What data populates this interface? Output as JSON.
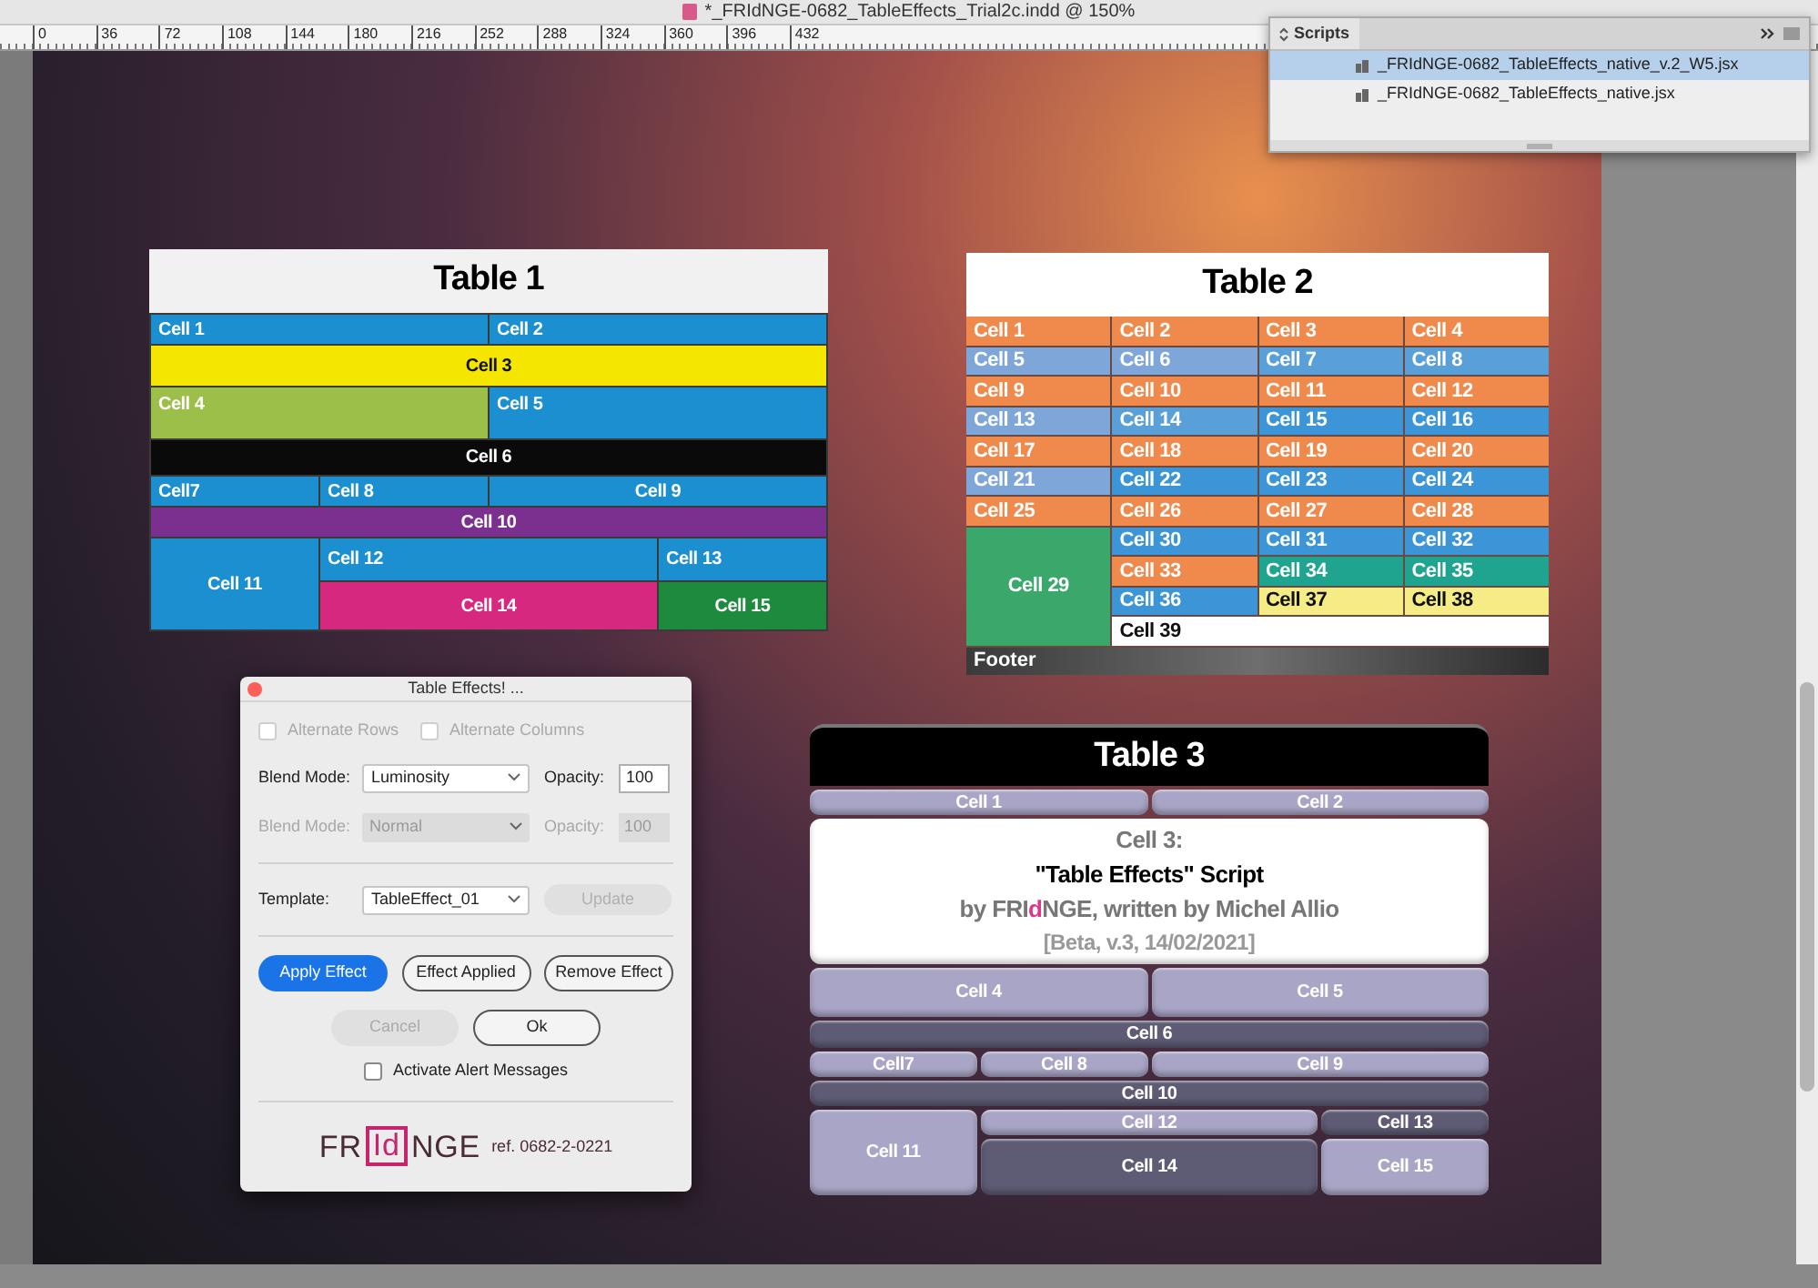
{
  "window": {
    "title": "*_FRIdNGE-0682_TableEffects_Trial2c.indd @ 150%"
  },
  "ruler": {
    "ticks": [
      "0",
      "36",
      "72",
      "108",
      "144",
      "180",
      "216",
      "252",
      "288",
      "324",
      "360",
      "396",
      "432"
    ]
  },
  "scripts_panel": {
    "tab": "Scripts",
    "items": [
      {
        "label": "_FRIdNGE-0682_TableEffects_native_v.2_W5.jsx",
        "selected": true
      },
      {
        "label": "_FRIdNGE-0682_TableEffects_native.jsx",
        "selected": false
      }
    ]
  },
  "table_1": {
    "title": "Table 1",
    "cells": [
      {
        "text": "Cell 1",
        "color": "#1b8fd0"
      },
      {
        "text": "Cell 2",
        "color": "#1b8fd0"
      },
      {
        "text": "Cell 3",
        "color": "#f5e600"
      },
      {
        "text": "Cell 4",
        "color": "#9cbf4a"
      },
      {
        "text": "Cell 5",
        "color": "#1b8fd0"
      },
      {
        "text": "Cell 6",
        "color": "#0a0a0a"
      },
      {
        "text": "Cell7",
        "color": "#1b8fd0"
      },
      {
        "text": "Cell 8",
        "color": "#1b8fd0"
      },
      {
        "text": "Cell 9",
        "color": "#1b8fd0"
      },
      {
        "text": "Cell 10",
        "color": "#7b2f8f"
      },
      {
        "text": "Cell 11",
        "color": "#1b8fd0"
      },
      {
        "text": "Cell 12",
        "color": "#1b8fd0"
      },
      {
        "text": "Cell 13",
        "color": "#1b8fd0"
      },
      {
        "text": "Cell 14",
        "color": "#d6287e"
      },
      {
        "text": "Cell 15",
        "color": "#1e8a3e"
      }
    ]
  },
  "table_2": {
    "title": "Table 2",
    "cells": [
      {
        "text": "Cell 1",
        "color": "#ef8a4c"
      },
      {
        "text": "Cell 2",
        "color": "#ef8a4c"
      },
      {
        "text": "Cell 3",
        "color": "#ef8a4c"
      },
      {
        "text": "Cell 4",
        "color": "#ef8a4c"
      },
      {
        "text": "Cell 5",
        "color": "#7fa6d8"
      },
      {
        "text": "Cell 6",
        "color": "#7fa6d8"
      },
      {
        "text": "Cell 7",
        "color": "#5aa0d8"
      },
      {
        "text": "Cell 8",
        "color": "#5aa0d8"
      },
      {
        "text": "Cell 9",
        "color": "#ef8a4c"
      },
      {
        "text": "Cell 10",
        "color": "#ef8a4c"
      },
      {
        "text": "Cell 11",
        "color": "#ef8a4c"
      },
      {
        "text": "Cell 12",
        "color": "#ef8a4c"
      },
      {
        "text": "Cell 13",
        "color": "#7fa6d8"
      },
      {
        "text": "Cell 14",
        "color": "#5aa0d8"
      },
      {
        "text": "Cell 15",
        "color": "#3c95d6"
      },
      {
        "text": "Cell 16",
        "color": "#3c95d6"
      },
      {
        "text": "Cell 17",
        "color": "#ef8a4c"
      },
      {
        "text": "Cell 18",
        "color": "#ef8a4c"
      },
      {
        "text": "Cell 19",
        "color": "#ef8a4c"
      },
      {
        "text": "Cell 20",
        "color": "#ef8a4c"
      },
      {
        "text": "Cell 21",
        "color": "#7fa6d8"
      },
      {
        "text": "Cell 22",
        "color": "#3c95d6"
      },
      {
        "text": "Cell 23",
        "color": "#3c95d6"
      },
      {
        "text": "Cell 24",
        "color": "#3c95d6"
      },
      {
        "text": "Cell 25",
        "color": "#ef8a4c"
      },
      {
        "text": "Cell 26",
        "color": "#ef8a4c"
      },
      {
        "text": "Cell 27",
        "color": "#ef8a4c"
      },
      {
        "text": "Cell 28",
        "color": "#ef8a4c"
      },
      {
        "text": "Cell 29",
        "color": "#3aa86a"
      },
      {
        "text": "Cell 30",
        "color": "#3c95d6"
      },
      {
        "text": "Cell 31",
        "color": "#3c95d6"
      },
      {
        "text": "Cell 32",
        "color": "#3c95d6"
      },
      {
        "text": "Cell 33",
        "color": "#ef8a4c"
      },
      {
        "text": "Cell 34",
        "color": "#1fa58f"
      },
      {
        "text": "Cell 35",
        "color": "#1fa58f"
      },
      {
        "text": "Cell 36",
        "color": "#3c95d6"
      },
      {
        "text": "Cell 37",
        "color": "#f6ec86"
      },
      {
        "text": "Cell 38",
        "color": "#f6ec86"
      },
      {
        "text": "Cell 39",
        "color": "#ffffff"
      }
    ],
    "footer": "Footer"
  },
  "table_3": {
    "title": "Table 3",
    "cells": [
      {
        "text": "Cell 1",
        "color": "#a9a5c6"
      },
      {
        "text": "Cell 2",
        "color": "#a9a5c6"
      },
      {
        "lines": [
          {
            "kind": "label",
            "parts": [
              {
                "text": "Cell 3:"
              }
            ]
          },
          {
            "kind": "title",
            "parts": [
              {
                "text": "\"Table Effects\" Script"
              }
            ]
          },
          {
            "kind": "byline",
            "parts": [
              {
                "text": "by FRI"
              },
              {
                "text": "d",
                "color": "#e0358a"
              },
              {
                "text": "NGE, written by Michel Allio"
              }
            ]
          },
          {
            "kind": "version",
            "parts": [
              {
                "text": "[Beta, v.3, 14/02/2021]"
              }
            ]
          }
        ],
        "color": "#ffffff"
      },
      {
        "text": "Cell 4",
        "color": "#a9a5c6"
      },
      {
        "text": "Cell 5",
        "color": "#a9a5c6"
      },
      {
        "text": "Cell 6",
        "color": "#5e5b74"
      },
      {
        "text": "Cell7",
        "color": "#a9a5c6"
      },
      {
        "text": "Cell 8",
        "color": "#a9a5c6"
      },
      {
        "text": "Cell 9",
        "color": "#a9a5c6"
      },
      {
        "text": "Cell 10",
        "color": "#5e5b74"
      },
      {
        "text": "Cell 11",
        "color": "#a9a5c6"
      },
      {
        "text": "Cell 12",
        "color": "#a9a5c6"
      },
      {
        "text": "Cell 13",
        "color": "#5e5b74"
      },
      {
        "text": "Cell 14",
        "color": "#5e5b74"
      },
      {
        "text": "Cell 15",
        "color": "#a9a5c6"
      }
    ]
  },
  "dialog": {
    "title": "Table Effects! ...",
    "options": [
      {
        "label": "Alternate Rows",
        "checked": false,
        "disabled": true
      },
      {
        "label": "Alternate Columns",
        "checked": false,
        "disabled": true
      }
    ],
    "blend_rows": [
      {
        "label": "Blend Mode:",
        "mode": "Luminosity",
        "opacity_label": "Opacity:",
        "opacity": "100",
        "disabled": false
      },
      {
        "label": "Blend Mode:",
        "mode": "Normal",
        "opacity_label": "Opacity:",
        "opacity": "100",
        "disabled": true
      }
    ],
    "template": {
      "label": "Template:",
      "value": "TableEffect_01",
      "button": {
        "label": "Update",
        "disabled": true
      }
    },
    "actions": [
      {
        "label": "Apply Effect",
        "kind": "primary"
      },
      {
        "label": "Effect Applied",
        "kind": "outline"
      },
      {
        "label": "Remove Effect",
        "kind": "outline"
      }
    ],
    "confirm": [
      {
        "label": "Cancel",
        "disabled": true
      },
      {
        "label": "Ok",
        "disabled": false
      }
    ],
    "alert": {
      "label": "Activate Alert Messages",
      "checked": false
    },
    "logo": {
      "parts": [
        "FR",
        "Id",
        "NGE"
      ],
      "ref": "ref. 0682-2-0221"
    }
  }
}
